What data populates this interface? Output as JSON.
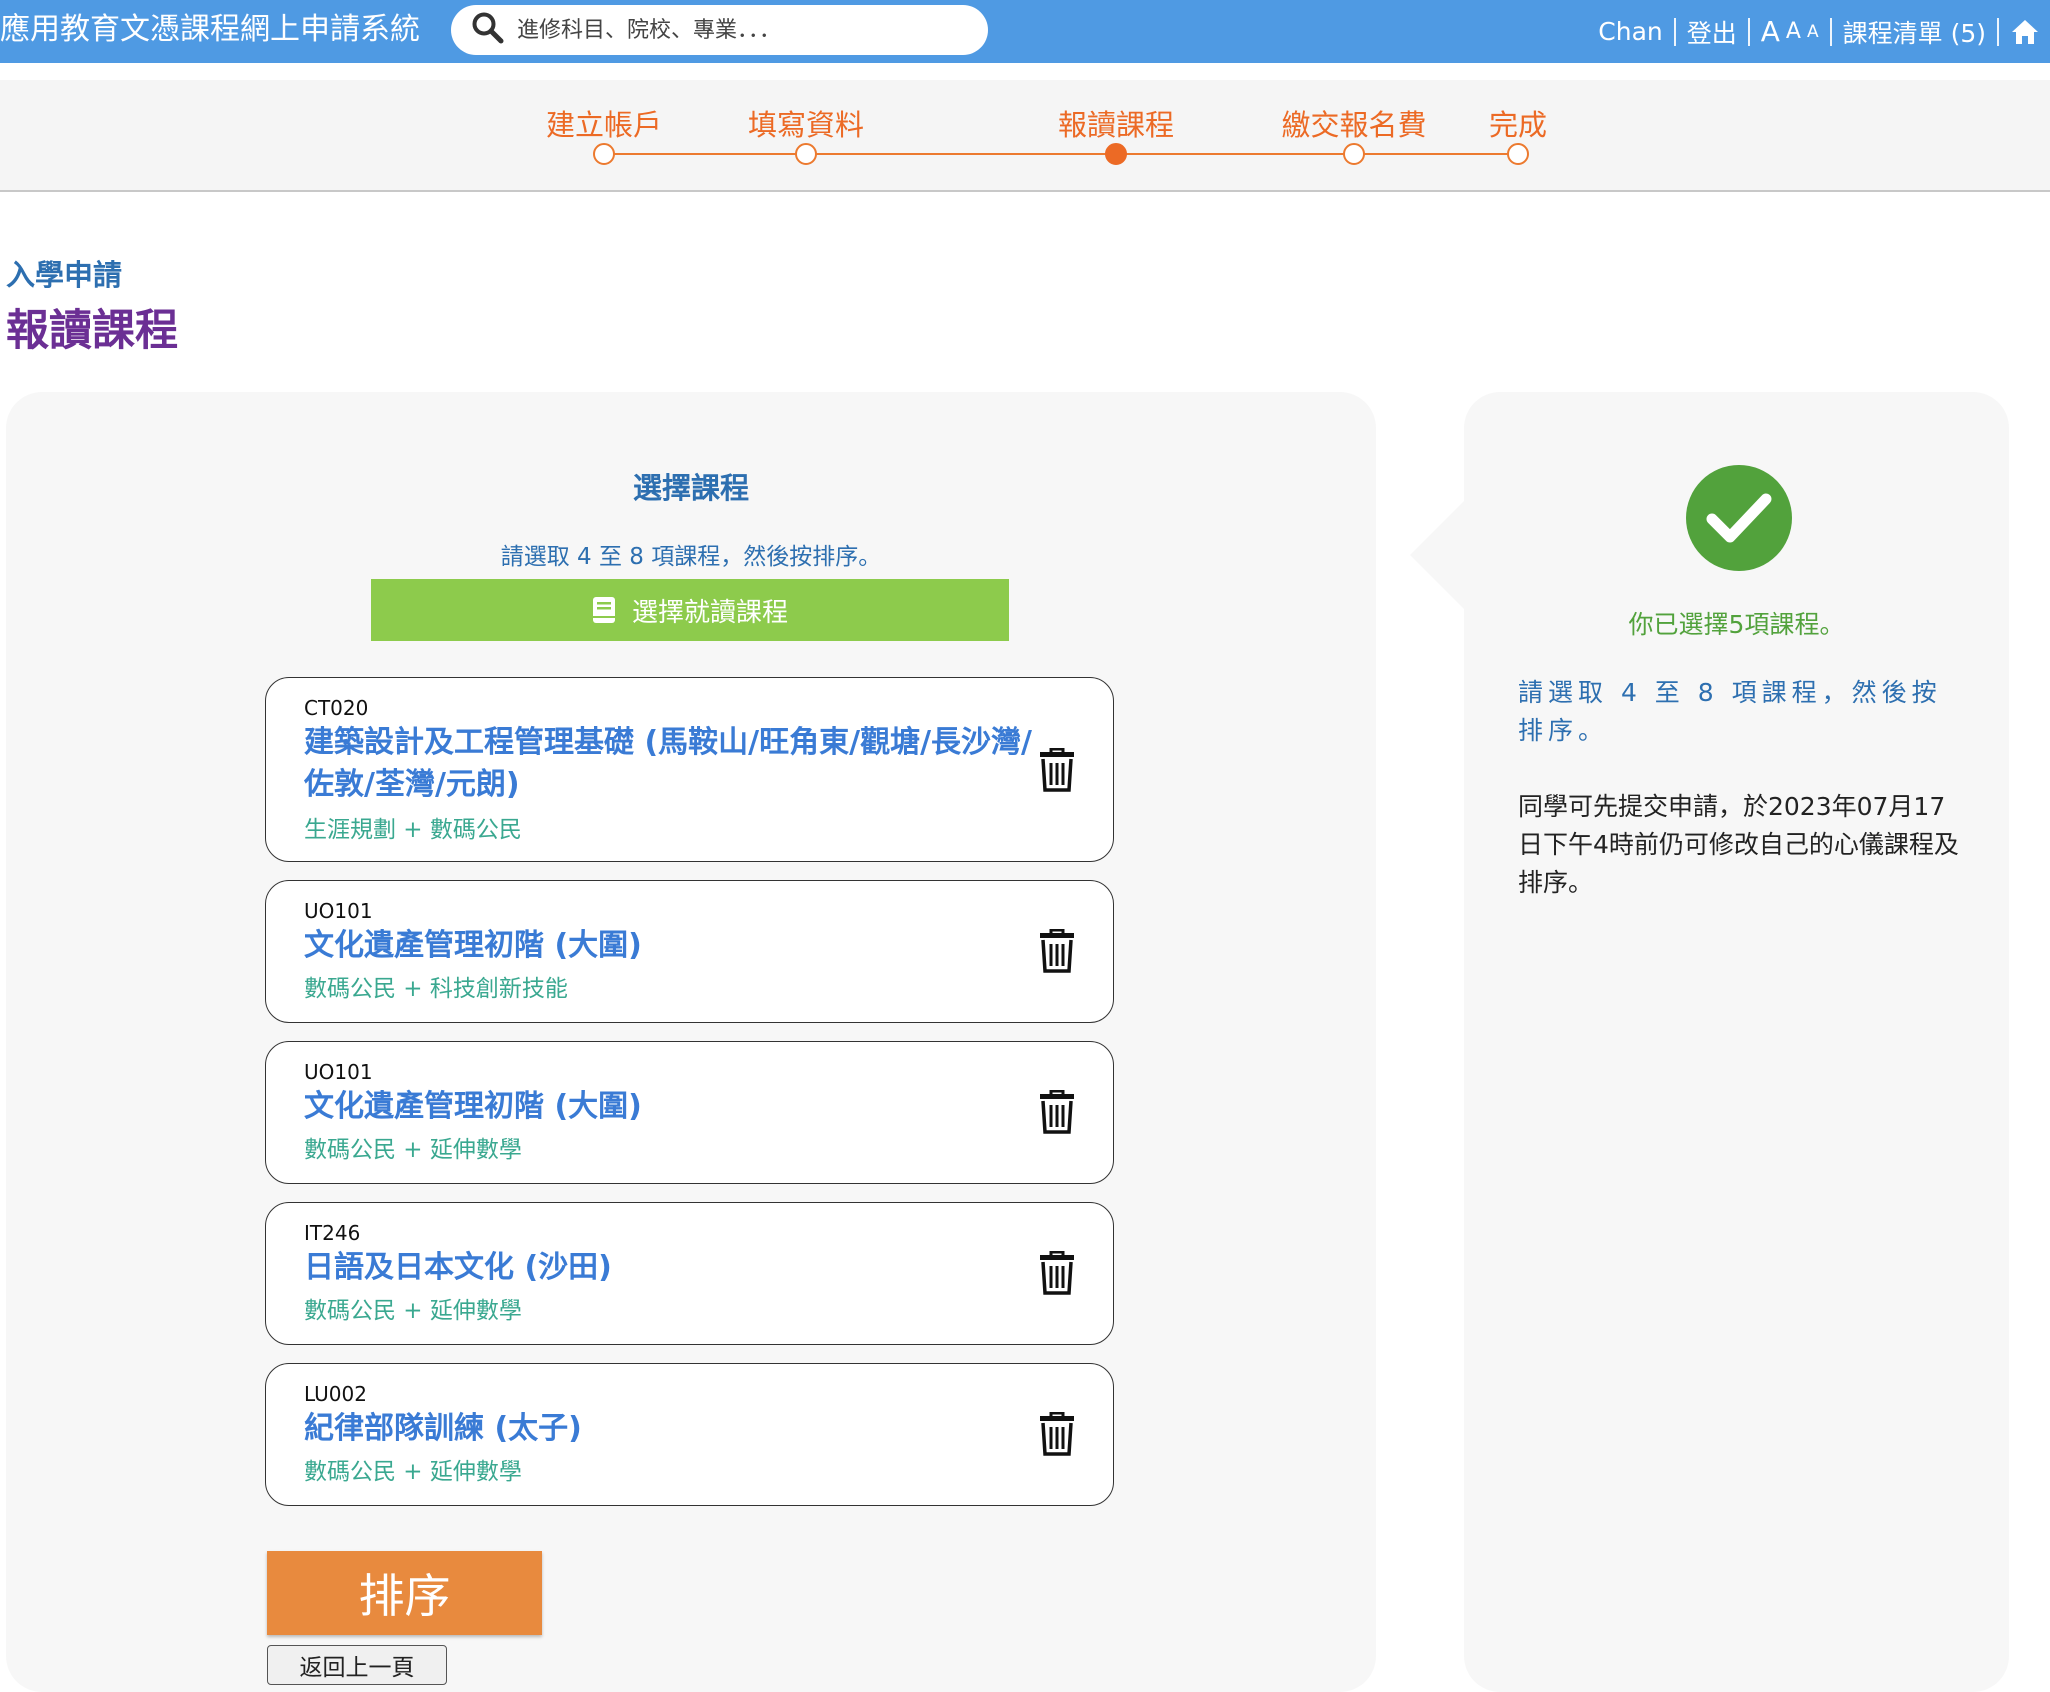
{
  "header": {
    "app_title": "應用教育文憑課程網上申請系統",
    "search_placeholder": "進修科目、院校、專業．．．",
    "user_name": "Chan",
    "logout_label": "登出",
    "font_large": "A",
    "font_medium": "A",
    "font_small": "A",
    "course_list_label": "課程清單 (5)"
  },
  "steps": [
    {
      "label": "建立帳戶",
      "active": false
    },
    {
      "label": "填寫資料",
      "active": false
    },
    {
      "label": "報讀課程",
      "active": true
    },
    {
      "label": "繳交報名費",
      "active": false
    },
    {
      "label": "完成",
      "active": false
    }
  ],
  "page": {
    "sub_heading": "入學申請",
    "title": "報讀課程"
  },
  "left_panel": {
    "title": "選擇課程",
    "hint": "請選取 4 至 8 項課程，然後按排序。",
    "select_button": "選擇就讀課程",
    "courses": [
      {
        "code": "CT020",
        "name": "建築設計及工程管理基礎 (馬鞍山/旺角東/觀塘/長沙灣/佐敦/荃灣/元朗)",
        "tags": "生涯規劃 + 數碼公民"
      },
      {
        "code": "UO101",
        "name": "文化遺產管理初階 (大圍)",
        "tags": "數碼公民 + 科技創新技能"
      },
      {
        "code": "UO101",
        "name": "文化遺產管理初階 (大圍)",
        "tags": "數碼公民 + 延伸數學"
      },
      {
        "code": "IT246",
        "name": "日語及日本文化 (沙田)",
        "tags": "數碼公民 + 延伸數學"
      },
      {
        "code": "LU002",
        "name": "紀律部隊訓練 (太子)",
        "tags": "數碼公民 + 延伸數學"
      }
    ],
    "sort_button": "排序",
    "back_button": "返回上一頁"
  },
  "right_panel": {
    "selected_text": "你已選擇5項課程。",
    "hint": "請選取 4 至 8 項課程，然後按排序。",
    "note": "同學可先提交申請，於2023年07月17日下午4時前仍可修改自己的心儀課程及排序。"
  },
  "colors": {
    "header_bg": "#4f9ae3",
    "step_orange": "#ec6a25",
    "heading_blue": "#2d6fb0",
    "title_purple": "#6b2f94",
    "select_green": "#8dcb4c",
    "sort_orange": "#e88a3e",
    "check_green": "#52a23c",
    "tag_teal": "#3aa890"
  },
  "icons": [
    "search-icon",
    "home-icon",
    "book-icon",
    "trash-icon",
    "check-icon"
  ]
}
